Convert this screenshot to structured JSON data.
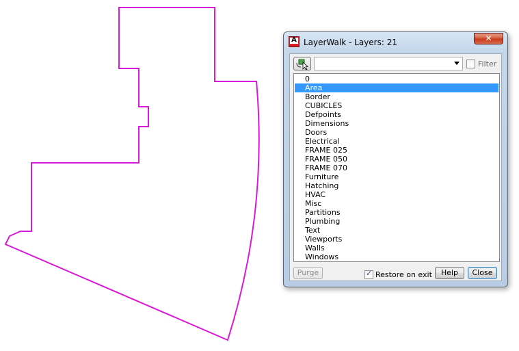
{
  "drawing": {
    "outline_color": "#d81ad8"
  },
  "dialog": {
    "title": "LayerWalk - Layers: 21",
    "app_icon_letter": "A",
    "close_glyph": "✕",
    "filter_label": "Filter",
    "filter_checked": false,
    "layers": [
      "0",
      "Area",
      "Border",
      "CUBICLES",
      "Defpoints",
      "Dimensions",
      "Doors",
      "Electrical",
      "FRAME 025",
      "FRAME 050",
      "FRAME 070",
      "Furniture",
      "Hatching",
      "HVAC",
      "Misc",
      "Partitions",
      "Plumbing",
      "Text",
      "Viewports",
      "Walls",
      "Windows"
    ],
    "selected_layer": "Area",
    "purge_label": "Purge",
    "restore_label": "Restore on exit",
    "restore_checked": true,
    "help_label": "Help",
    "close_label": "Close",
    "selection_color": "#3399ff"
  }
}
